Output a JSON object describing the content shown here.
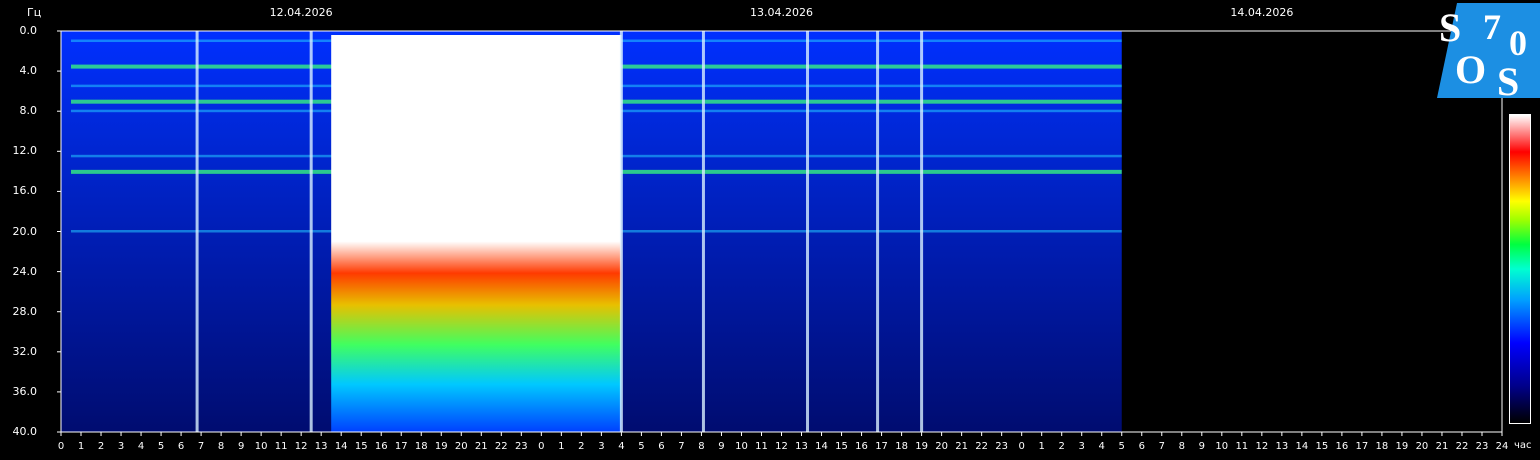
{
  "chart_data": {
    "type": "heatmap",
    "title": "",
    "ylabel": "Гц",
    "xlabel": "час",
    "ylim": [
      0,
      40
    ],
    "y_ticks": [
      "0.0",
      "4.0",
      "8.0",
      "12.0",
      "16.0",
      "20.0",
      "24.0",
      "28.0",
      "32.0",
      "36.0",
      "40.0"
    ],
    "x_ticks": [
      "0",
      "1",
      "2",
      "3",
      "4",
      "5",
      "6",
      "7",
      "8",
      "9",
      "10",
      "11",
      "12",
      "13",
      "14",
      "15",
      "16",
      "17",
      "18",
      "19",
      "20",
      "21",
      "22",
      "23",
      "0",
      "1",
      "2",
      "3",
      "4",
      "5",
      "6",
      "7",
      "8",
      "9",
      "10",
      "11",
      "12",
      "13",
      "14",
      "15",
      "16",
      "17",
      "18",
      "19",
      "20",
      "21",
      "22",
      "23",
      "0",
      "1",
      "2",
      "3",
      "4",
      "5",
      "6",
      "7",
      "8",
      "9",
      "10",
      "11",
      "12",
      "13",
      "14",
      "15",
      "16",
      "17",
      "18",
      "19",
      "20",
      "21",
      "22",
      "23",
      "24"
    ],
    "dates": [
      {
        "label": "12.04.2026",
        "hour": 12
      },
      {
        "label": "13.04.2026",
        "hour": 36
      },
      {
        "label": "14.04.2026",
        "hour": 60
      }
    ],
    "data_end_hour": 53,
    "resonance_bands_hz": [
      1.0,
      3.5,
      5.5,
      7.0,
      8.0,
      12.5,
      14.0,
      20.0
    ],
    "high_intensity_period": {
      "start_hour": 13.5,
      "end_hour": 28.0,
      "saturated_above_hz": 22
    },
    "spikes_hours": [
      6.8,
      12.5,
      28.0,
      32.1,
      37.3,
      40.8,
      43.0
    ]
  },
  "logo": {
    "letters": [
      "S",
      "7",
      "0",
      "O",
      "S"
    ]
  },
  "colorbar": {
    "low_color": "#000000",
    "high_color": "#ffffff"
  }
}
